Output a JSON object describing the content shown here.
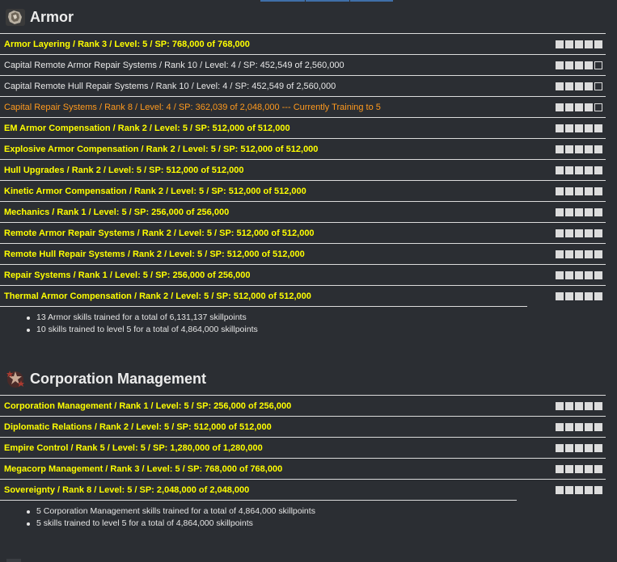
{
  "sections": [
    {
      "title": "Armor",
      "icon": "armor-icon",
      "rows": [
        {
          "text": "Armor Layering / Rank 3 / Level: 5 / SP: 768,000 of 768,000",
          "state": "complete",
          "level": 5
        },
        {
          "text": "Capital Remote Armor Repair Systems / Rank 10 / Level: 4 / SP: 452,549 of 2,560,000",
          "state": "partial",
          "level": 4
        },
        {
          "text": "Capital Remote Hull Repair Systems / Rank 10 / Level: 4 / SP: 452,549 of 2,560,000",
          "state": "partial",
          "level": 4
        },
        {
          "text": "Capital Repair Systems / Rank 8 / Level: 4 / SP: 362,039 of 2,048,000 --- Currently Training to 5",
          "state": "training",
          "level": 4
        },
        {
          "text": "EM Armor Compensation / Rank 2 / Level: 5 / SP: 512,000 of 512,000",
          "state": "complete",
          "level": 5
        },
        {
          "text": "Explosive Armor Compensation / Rank 2 / Level: 5 / SP: 512,000 of 512,000",
          "state": "complete",
          "level": 5
        },
        {
          "text": "Hull Upgrades / Rank 2 / Level: 5 / SP: 512,000 of 512,000",
          "state": "complete",
          "level": 5
        },
        {
          "text": "Kinetic Armor Compensation / Rank 2 / Level: 5 / SP: 512,000 of 512,000",
          "state": "complete",
          "level": 5
        },
        {
          "text": "Mechanics / Rank 1 / Level: 5 / SP: 256,000 of 256,000",
          "state": "complete",
          "level": 5
        },
        {
          "text": "Remote Armor Repair Systems / Rank 2 / Level: 5 / SP: 512,000 of 512,000",
          "state": "complete",
          "level": 5
        },
        {
          "text": "Remote Hull Repair Systems / Rank 2 / Level: 5 / SP: 512,000 of 512,000",
          "state": "complete",
          "level": 5
        },
        {
          "text": "Repair Systems / Rank 1 / Level: 5 / SP: 256,000 of 256,000",
          "state": "complete",
          "level": 5
        },
        {
          "text": "Thermal Armor Compensation / Rank 2 / Level: 5 / SP: 512,000 of 512,000",
          "state": "complete",
          "level": 5
        }
      ],
      "summary": [
        "13 Armor skills trained for a total of 6,131,137 skillpoints",
        "10 skills trained to level 5 for a total of 4,864,000 skillpoints"
      ]
    },
    {
      "title": "Corporation Management",
      "icon": "corporation-management-icon",
      "rows": [
        {
          "text": "Corporation Management / Rank 1 / Level: 5 / SP: 256,000 of 256,000",
          "state": "complete",
          "level": 5
        },
        {
          "text": "Diplomatic Relations / Rank 2 / Level: 5 / SP: 512,000 of 512,000",
          "state": "complete",
          "level": 5
        },
        {
          "text": "Empire Control / Rank 5 / Level: 5 / SP: 1,280,000 of 1,280,000",
          "state": "complete",
          "level": 5
        },
        {
          "text": "Megacorp Management / Rank 3 / Level: 5 / SP: 768,000 of 768,000",
          "state": "complete",
          "level": 5
        },
        {
          "text": "Sovereignty / Rank 8 / Level: 5 / SP: 2,048,000 of 2,048,000",
          "state": "complete",
          "level": 5
        }
      ],
      "summary": [
        "5 Corporation Management skills trained for a total of 4,864,000 skillpoints",
        "5 skills trained to level 5 for a total of 4,864,000 skillpoints"
      ]
    }
  ],
  "max_level": 5
}
